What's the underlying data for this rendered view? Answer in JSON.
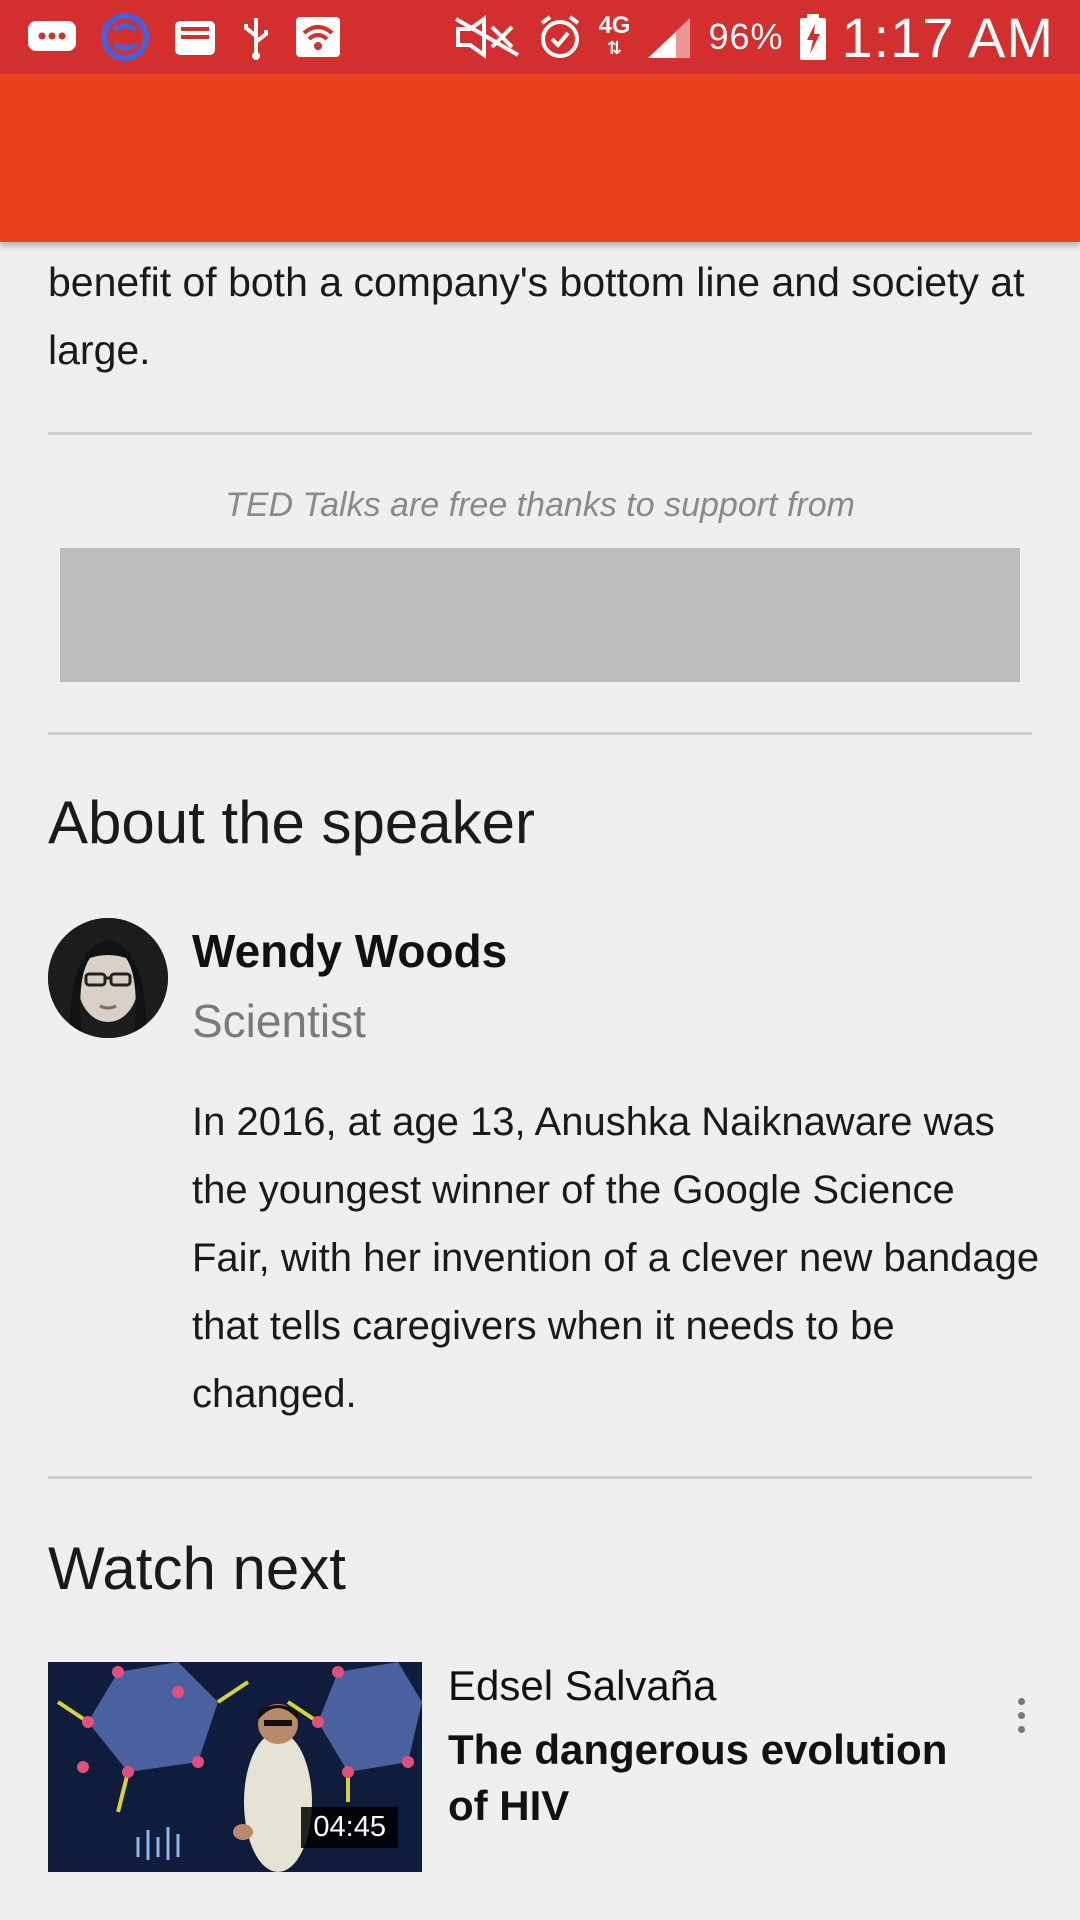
{
  "status_bar": {
    "battery": "96%",
    "network": "4G",
    "time": "1:17 AM",
    "icons": [
      "message-icon",
      "sync-icon",
      "inbox-icon",
      "usb-icon",
      "wifi-icon",
      "mute-icon",
      "alarm-icon",
      "network-4g-icon",
      "signal-icon",
      "battery-charging-icon"
    ]
  },
  "colors": {
    "status_bar": "#d32f2f",
    "app_bar": "#e8411b",
    "background": "#efefef"
  },
  "intro": {
    "text": "benefit of both a company's bottom line and society at large."
  },
  "sponsor": {
    "text": "TED Talks are free thanks to support from"
  },
  "about": {
    "heading": "About the speaker",
    "name": "Wendy Woods",
    "title": "Scientist",
    "bio": "In 2016, at age 13, Anushka Naiknaware was the youngest winner of the Google Science Fair, with her invention of a clever new bandage that tells caregivers when it needs to be changed."
  },
  "watch_next": {
    "heading": "Watch next",
    "items": [
      {
        "speaker": "Edsel Salvaña",
        "title": "The dangerous evolution of HIV",
        "duration": "04:45"
      }
    ]
  }
}
